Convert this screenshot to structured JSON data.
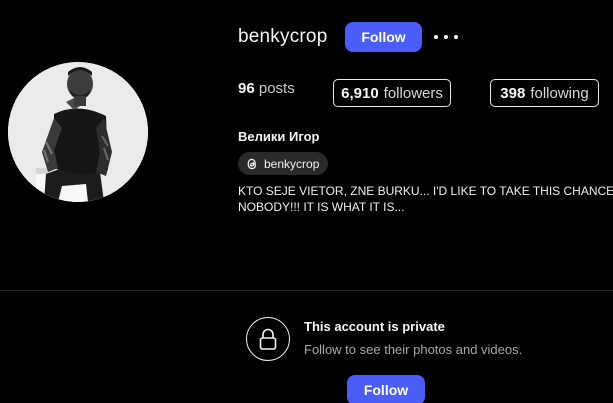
{
  "profile": {
    "username": "benkycrop",
    "follow_label": "Follow",
    "more_icon": "more-horizontal-icon",
    "avatar_icon": "profile-photo"
  },
  "stats": {
    "posts_count": "96",
    "posts_label": "posts",
    "followers_count": "6,910",
    "followers_label": "followers",
    "following_count": "398",
    "following_label": "following"
  },
  "bio": {
    "full_name": "Велики Игор",
    "threads_handle": "benkycrop",
    "threads_icon": "threads-icon",
    "line1": "KTO SEJE VIETOR, ZNE BURKU... I'D LIKE TO TAKE THIS CHANCE T",
    "line2": "NOBODY!!! IT IS WHAT IT IS..."
  },
  "private_notice": {
    "icon": "lock-icon",
    "title": "This account is private",
    "subtitle": "Follow to see their photos and videos.",
    "follow_label": "Follow"
  },
  "colors": {
    "background": "#000000",
    "accent": "#4a5df9",
    "muted_text": "#a8a8a8",
    "pill_bg": "#2a2a2a"
  }
}
